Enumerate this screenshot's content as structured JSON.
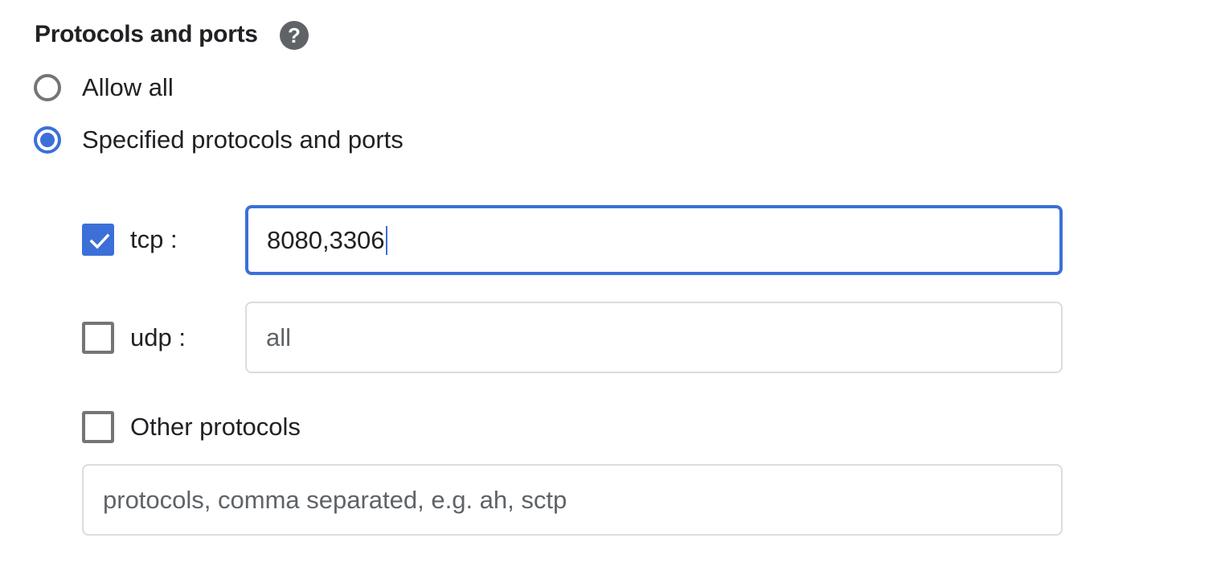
{
  "section": {
    "title": "Protocols and ports",
    "help_icon": "help-circle-icon"
  },
  "mode": {
    "options": [
      {
        "label": "Allow all",
        "selected": false
      },
      {
        "label": "Specified protocols and ports",
        "selected": true
      }
    ]
  },
  "protocols": {
    "tcp": {
      "label": "tcp :",
      "checked": true,
      "value": "8080,3306",
      "placeholder": ""
    },
    "udp": {
      "label": "udp :",
      "checked": false,
      "value": "",
      "placeholder": "all"
    },
    "other": {
      "label": "Other protocols",
      "checked": false,
      "value": "",
      "placeholder": "protocols, comma separated, e.g. ah, sctp"
    }
  },
  "colors": {
    "accent": "#3c6fd8",
    "border": "#dadce0",
    "unchecked": "#757575",
    "text": "#202124"
  }
}
